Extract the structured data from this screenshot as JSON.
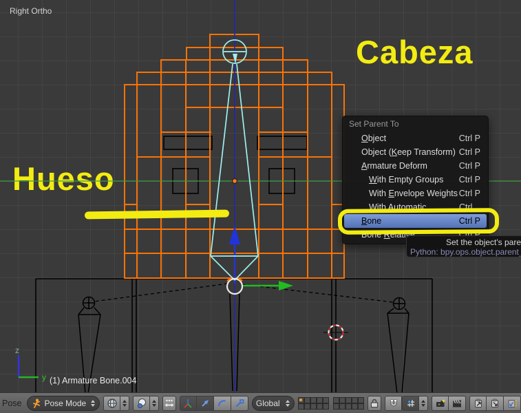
{
  "viewport": {
    "view_label": "Right Ortho",
    "object_label": "(1) Armature Bone.004",
    "axis": {
      "z": "z",
      "y": "y"
    },
    "annotations": {
      "cabeza": "Cabeza",
      "hueso": "Hueso"
    }
  },
  "context_menu": {
    "title": "Set Parent To",
    "items": [
      {
        "label": "Object",
        "accel": 0,
        "indent": false,
        "highlighted": false,
        "shortcut": "Ctrl P"
      },
      {
        "label": "Object (Keep Transform)",
        "accel": 8,
        "indent": false,
        "highlighted": false,
        "shortcut": "Ctrl P"
      },
      {
        "label": "Armature Deform",
        "accel": 0,
        "indent": false,
        "highlighted": false,
        "shortcut": "Ctrl P"
      },
      {
        "label": "With Empty Groups",
        "accel": 0,
        "indent": true,
        "highlighted": false,
        "shortcut": "Ctrl P"
      },
      {
        "label": "With Envelope Weights",
        "accel": 5,
        "indent": true,
        "highlighted": false,
        "shortcut": "Ctrl P"
      },
      {
        "label": "With Automatic Weights",
        "accel": 5,
        "indent": true,
        "highlighted": false,
        "shortcut": "Ctrl P"
      },
      {
        "label": "Bone",
        "accel": 0,
        "indent": false,
        "highlighted": true,
        "shortcut": "Ctrl P"
      },
      {
        "label": "Bone Relative",
        "accel": 5,
        "indent": false,
        "highlighted": false,
        "shortcut": "Ctrl P"
      }
    ]
  },
  "tooltip": {
    "line1": "Set the object's paren",
    "line2": "Python: bpy.ops.object.parent_se"
  },
  "header": {
    "menu_label": "Pose",
    "mode_value": "Pose Mode",
    "orientation_value": "Global",
    "layers": {
      "groups": 2,
      "per_group": 10,
      "active_index": 0
    },
    "icon_names": [
      "pose-mode-icon",
      "viewport-shading-icon",
      "pivot-point-icon",
      "manipulator-toggle-icon",
      "translate-manipulator-icon",
      "rotate-manipulator-icon",
      "scale-manipulator-icon",
      "lock-to-scene-icon",
      "snap-magnet-icon",
      "snap-element-icon",
      "render-camera-icon",
      "render-animation-icon",
      "copy-pose-icon",
      "paste-pose-icon",
      "paste-flipped-pose-icon"
    ]
  },
  "colors": {
    "annotation_yellow": "#f2ec12",
    "mesh_selected_orange": "#f97306",
    "active_bone_cyan": "#9ff0ee",
    "axis_y_green": "#3e9e3e",
    "axis_z_blue": "#2424a8",
    "menu_highlight_top": "#7e9cd8",
    "menu_highlight_bottom": "#5372b5"
  }
}
